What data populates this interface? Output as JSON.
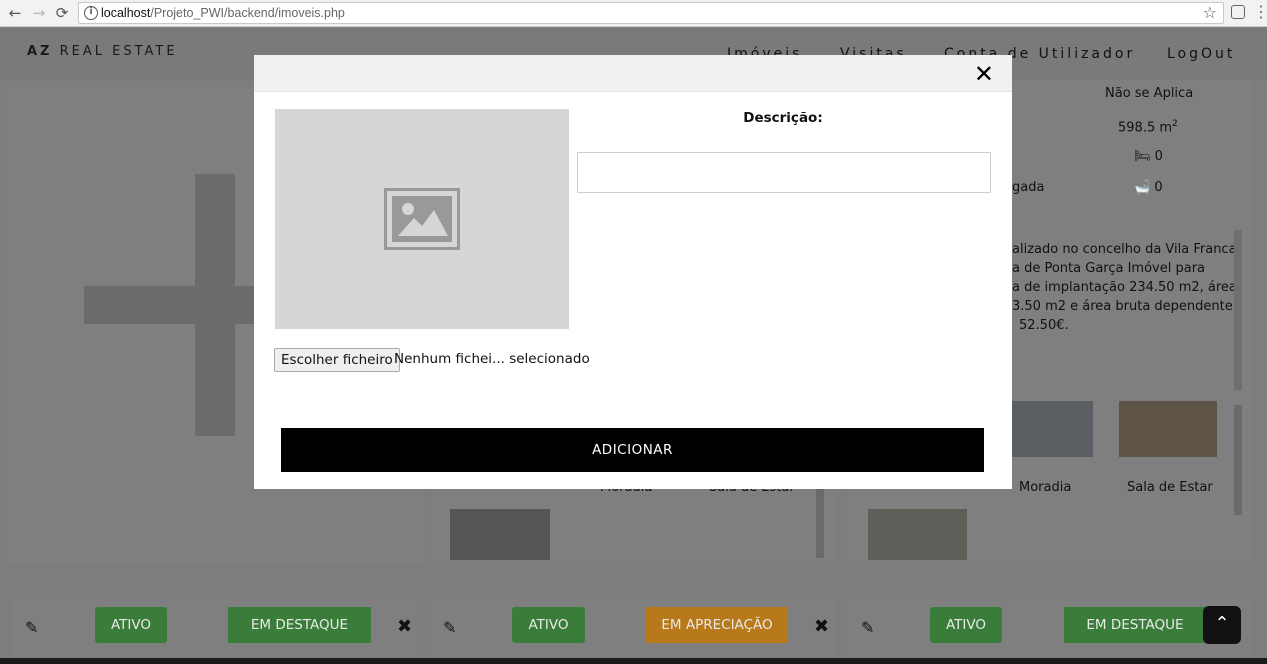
{
  "browser": {
    "back": "←",
    "forward": "→",
    "reload": "⟳",
    "url_host": "localhost",
    "url_path": "/Projeto_PWI/backend/imoveis.php",
    "star": "☆",
    "menu": "⋮"
  },
  "header": {
    "brand_bold": "AZ",
    "brand_rest": " REAL ESTATE",
    "nav": [
      "Imóveis",
      "Visitas",
      "Conta de Utilizador",
      "LogOut"
    ]
  },
  "background": {
    "property_details": {
      "type_value": "Não se Aplica",
      "area_value": "598.5 m",
      "area_sup": "2",
      "bedrooms": "0",
      "bathrooms": "0",
      "partial_label": "gada"
    },
    "description_lines": [
      "alizado no concelho da Vila Franca",
      "a de Ponta Garça Imóvel para",
      "a de implantação 234.50 m2, área",
      "3.50 m2 e área bruta dependente",
      "52.50€."
    ],
    "photo_captions_right": [
      "Moradia",
      "Sala de Estar"
    ],
    "photo_captions_mid": [
      "Moradia",
      "Sala de Estar"
    ],
    "status_buttons": [
      {
        "label": "ATIVO",
        "color": "#3a7d3a"
      },
      {
        "label": "EM DESTAQUE",
        "color": "#3a7d3a"
      },
      {
        "label": "ATIVO",
        "color": "#3a7d3a"
      },
      {
        "label": "EM APRECIAÇÃO",
        "color": "#b8791a"
      },
      {
        "label": "ATIVO",
        "color": "#3a7d3a"
      },
      {
        "label": "EM DESTAQUE",
        "color": "#3a7d3a"
      }
    ],
    "edit_icon": "✎",
    "delete_icon": "✖",
    "scroll_top_icon": "⌃"
  },
  "modal": {
    "close_icon": "✕",
    "description_label": "Descrição:",
    "description_value": "",
    "file_button": "Escolher ficheiro",
    "file_status": "Nenhum fichei... selecionado",
    "submit": "ADICIONAR"
  },
  "colors": {
    "overlay": "#7d7d7d",
    "status_green": "#3a7d3a",
    "status_orange": "#b8791a",
    "submit_bg": "#000000"
  }
}
